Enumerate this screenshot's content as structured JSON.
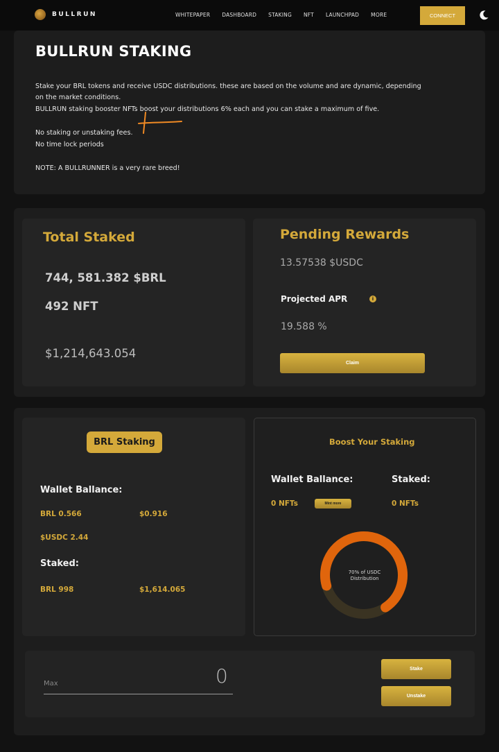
{
  "nav": {
    "brand": "BULLRUN",
    "links": [
      "WHITEPAPER",
      "DASHBOARD",
      "STAKING",
      "NFT",
      "LAUNCHPAD",
      "MORE"
    ],
    "connect_label": "CONNECT",
    "theme_icon": "moon-icon"
  },
  "intro": {
    "title": "BULLRUN STAKING",
    "line1": "Stake your BRL tokens and receive USDC distributions. these are based on the volume and are dynamic, depending",
    "line2": "on the market conditions.",
    "line3": "BULLRUN staking  booster NFTs boost your distributions 6% each and you can stake a maximum of five.",
    "line4": "No staking or unstaking fees.",
    "line5": "No time lock periods",
    "note": "NOTE: A BULLRUNNER is a very rare breed!"
  },
  "total_staked": {
    "title": "Total Staked",
    "brl": "744, 581.382 $BRL",
    "nft": "492 NFT",
    "usd": "$1,214,643.054"
  },
  "pending_rewards": {
    "title": "Pending Rewards",
    "amount": "13.57538 $USDC",
    "apr_label": "Projected APR",
    "apr_value": "19.588 %",
    "claim_label": "Claim"
  },
  "brl_staking": {
    "title": "BRL Staking",
    "wallet_label": "Wallet Ballance:",
    "brl_balance": "BRL 0.566",
    "brl_usd": "$0.916",
    "usdc_balance": "$USDC 2.44",
    "staked_label": "Staked:",
    "brl_staked": "BRL 998",
    "staked_usd": "$1,614.065"
  },
  "boost": {
    "title": "Boost Your Staking",
    "wallet_label": "Wallet Ballance:",
    "staked_label": "Staked:",
    "wallet_nfts": "0 NFTs",
    "mint_label": "Mint more",
    "staked_nfts": "0 NFTs",
    "donut_label_1": "70% of USDC",
    "donut_label_2": "Distribution",
    "donut_fraction": 0.7
  },
  "stake_form": {
    "placeholder": "Max",
    "value": "0",
    "stake_label": "Stake",
    "unstake_label": "Unstake"
  },
  "colors": {
    "accent": "#d4a93a",
    "donut_fill": "#e0650c",
    "donut_track": "#3a3322"
  }
}
